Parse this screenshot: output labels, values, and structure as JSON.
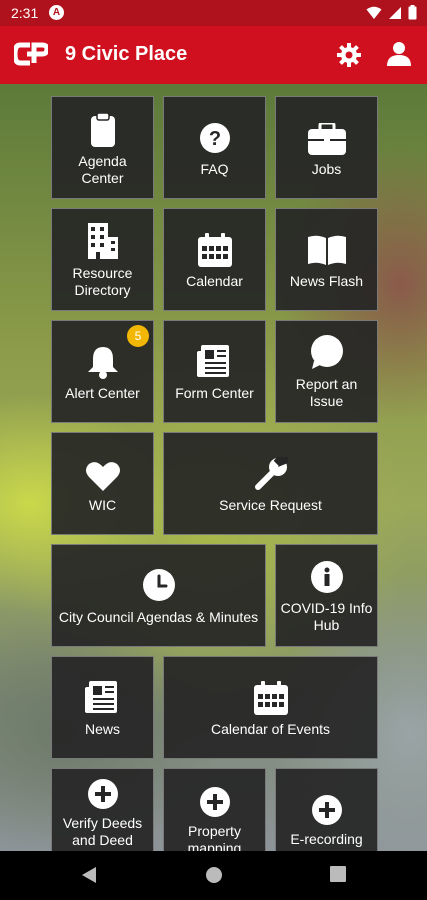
{
  "status_bar": {
    "time": "2:31",
    "notification_icon": "a-circle-icon",
    "icons": [
      "wifi-icon",
      "signal-icon",
      "battery-icon"
    ]
  },
  "app_bar": {
    "title": "9 Civic Place",
    "logo_icon": "civicplus-logo-icon",
    "settings_icon": "gear-icon",
    "account_icon": "user-icon",
    "color": "#d0101e"
  },
  "tiles": [
    {
      "label": "Agenda\nCenter",
      "icon": "clipboard-icon"
    },
    {
      "label": "FAQ",
      "icon": "question-circle-icon"
    },
    {
      "label": "Jobs",
      "icon": "briefcase-icon"
    },
    {
      "label": "Resource\nDirectory",
      "icon": "building-icon"
    },
    {
      "label": "Calendar",
      "icon": "calendar-icon"
    },
    {
      "label": "News Flash",
      "icon": "open-book-icon"
    },
    {
      "label": "Alert Center",
      "icon": "bell-icon",
      "badge": "5"
    },
    {
      "label": "Form Center",
      "icon": "newspaper-icon"
    },
    {
      "label": "Report an\nIssue",
      "icon": "speech-bubble-icon"
    },
    {
      "label": "WIC",
      "icon": "heart-icon"
    },
    {
      "label": "Service Request",
      "icon": "wrench-icon"
    },
    {
      "label": "City Council Agendas & Minutes",
      "icon": "clock-icon"
    },
    {
      "label": "COVID-19 Info\nHub",
      "icon": "info-circle-icon"
    },
    {
      "label": "News",
      "icon": "newspaper-icon"
    },
    {
      "label": "Calendar of Events",
      "icon": "calendar-icon"
    },
    {
      "label": "Verify Deeds\nand Deed",
      "icon": "plus-circle-icon"
    },
    {
      "label": "Property\nmapping",
      "icon": "plus-circle-icon"
    },
    {
      "label": "E-recording",
      "icon": "plus-circle-icon"
    }
  ],
  "nav_bar": {
    "icons": [
      "back-icon",
      "home-icon",
      "recents-icon"
    ]
  }
}
